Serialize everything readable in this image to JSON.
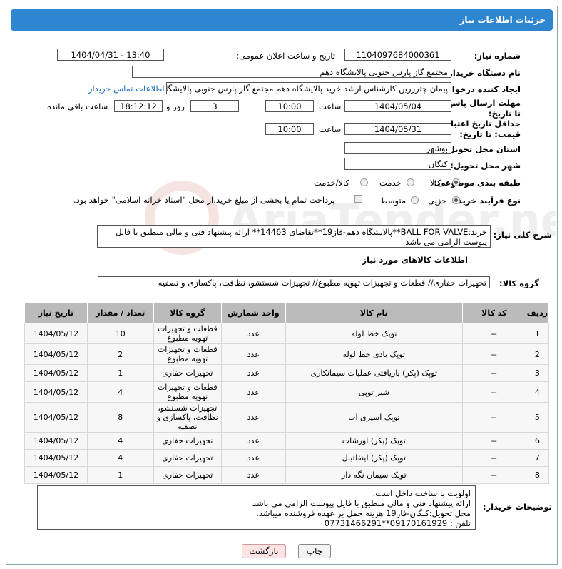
{
  "header": {
    "title": "جزئیات اطلاعات نیاز"
  },
  "fields": {
    "need_number_label": "شماره نیاز:",
    "need_number": "1104097684000361",
    "announce_label": "تاریخ و ساعت اعلان عمومی:",
    "announce_value": "1404/04/31 - 13:40",
    "buyer_org_label": "نام دستگاه خریدار:",
    "buyer_org": "مجتمع گاز پارس جنوبی  پالایشگاه دهم",
    "requester_label": "ایجاد کننده درخواست:",
    "requester": "پیمان چترزرین کارشناس ارشد خرید پالایشگاه دهم مجتمع گاز پارس جنوبی  پالایشگاه",
    "contact_link": "اطلاعات تماس خریدار",
    "deadline_label": "مهلت ارسال پاسخ: تا تاریخ:",
    "deadline_date": "1404/05/04",
    "time_label": "ساعت",
    "deadline_time": "10:00",
    "days": "3",
    "days_label": "روز و",
    "remaining_time": "18:12:12",
    "remaining_label": "ساعت باقی مانده",
    "validity_label": "حداقل تاریخ اعتبار قیمت: تا تاریخ:",
    "validity_date": "1404/05/31",
    "validity_time": "10:00",
    "province_label": "استان محل تحویل:",
    "province": "بوشهر",
    "city_label": "شهر محل تحویل:",
    "city": "کنگان",
    "category_label": "طبقه بندی موضوعی:",
    "cat_goods": "کالا",
    "cat_service": "خدمت",
    "cat_both": "کالا/خدمت",
    "process_label": "نوع فرآیند خرید :",
    "proc_partial": "جزیی",
    "proc_medium": "متوسط",
    "payment_note": "پرداخت تمام یا بخشی از مبلغ خرید،از محل \"اسناد خزانه اسلامی\" خواهد بود.",
    "desc_label": "شرح کلی نیاز:",
    "desc_line1": "خرید:BALL FOR VALVE**پالایشگاه دهم-فاز19**تقاضای 14463** ارائه پیشنهاد فنی و مالی منطبق با فایل",
    "desc_line2": "پیوست الزامی می باشد",
    "goods_info_title": "اطلاعات کالاهای مورد نیاز",
    "group_label": "گروه کالا:",
    "group_value": "تجهیزات حفاری//  قطعات و تجهیزات تهویه مطبوع// تجهیزات شستشو، نظافت، پاکسازی و تصفیه",
    "buyer_notes_label": "توضیحات خریدار:",
    "notes_line1": "اولویت با ساخت داخل است.",
    "notes_line2": " ارائه پیشنهاد فنی و مالی منطبق با فایل پیوست الزامی می باشد",
    "notes_line3": "محل تحویل:کنگان-فاز19 هزینه حمل بر عهده فروشنده میباشد.",
    "notes_line4": "تلفن : 09170161929**07731466291"
  },
  "table": {
    "headers": [
      "ردیف",
      "کد کالا",
      "نام کالا",
      "واحد شمارش",
      "گروه کالا",
      "تعداد / مقدار",
      "تاریخ نیاز"
    ],
    "rows": [
      [
        "1",
        "--",
        "توپک خط لوله",
        "عدد",
        "قطعات و تجهیزات تهویه مطبوع",
        "10",
        "1404/05/12"
      ],
      [
        "2",
        "--",
        "توپک بادی خط لوله",
        "عدد",
        "قطعات و تجهیزات تهویه مطبوع",
        "2",
        "1404/05/12"
      ],
      [
        "3",
        "--",
        "توپک (پکر) بازیافتی عملیات سیمانکاری",
        "عدد",
        "تجهیزات حفاری",
        "1",
        "1404/05/12"
      ],
      [
        "4",
        "--",
        "شیر توپی",
        "عدد",
        "قطعات و تجهیزات تهویه مطبوع",
        "4",
        "1404/05/12"
      ],
      [
        "5",
        "--",
        "توپک اسپری آب",
        "عدد",
        "تجهیزات شستشو، نظافت، پاکسازی و تصفیه",
        "8",
        "1404/05/12"
      ],
      [
        "6",
        "--",
        "توپک (پکر) اورشات",
        "عدد",
        "تجهیزات حفاری",
        "4",
        "1404/05/12"
      ],
      [
        "7",
        "--",
        "توپک (پکر) اینفلتیبل",
        "عدد",
        "تجهیزات حفاری",
        "4",
        "1404/05/12"
      ],
      [
        "8",
        "--",
        "توپک سیمان نگه دار",
        "عدد",
        "تجهیزات حفاری",
        "1",
        "1404/05/12"
      ]
    ]
  },
  "buttons": {
    "print": "چاپ",
    "back": "بازگشت"
  },
  "watermark_text": "AriaTender.neT"
}
